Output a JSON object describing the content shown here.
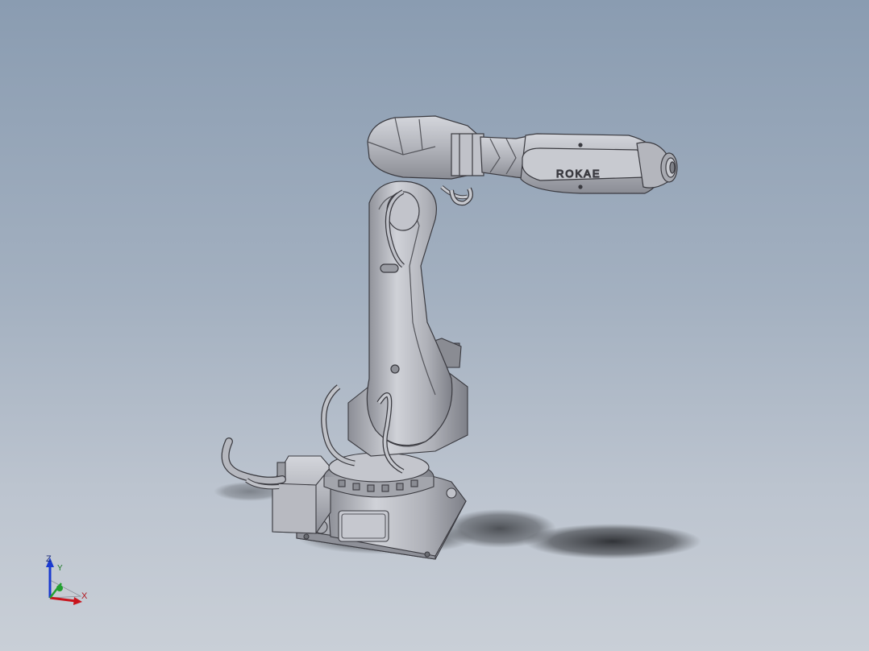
{
  "model": {
    "brand_logo": "ROKAE",
    "view": "isometric-shaded-with-edges"
  },
  "triad": {
    "z_label": "Z",
    "y_label": "Y",
    "x_label": "X"
  },
  "colors": {
    "background_top": "#8a9cb1",
    "background_bottom": "#c9cfd7",
    "robot_body": "#b3b5bc",
    "edge": "#3a3a40",
    "axis_x": "#c8141c",
    "axis_y": "#22a030",
    "axis_z": "#1a3ad0"
  },
  "icons": [
    "coordinate-triad-icon"
  ]
}
